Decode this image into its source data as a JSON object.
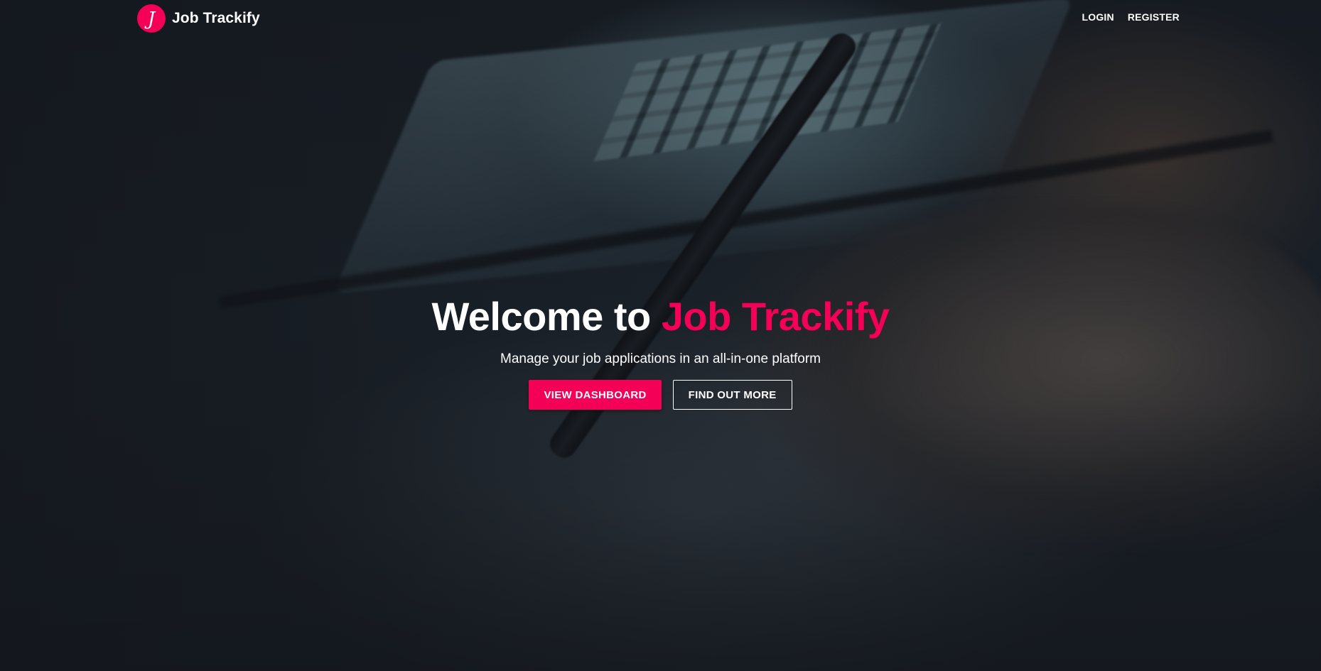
{
  "brand": {
    "logo_letter": "J",
    "name": "Job Trackify",
    "accent_color": "#f50057"
  },
  "nav": {
    "login_label": "LOGIN",
    "register_label": "REGISTER"
  },
  "hero": {
    "title_prefix": "Welcome to",
    "title_highlight": "Job Trackify",
    "subtitle": "Manage your job applications in an all-in-one platform",
    "primary_button_label": "VIEW DASHBOARD",
    "secondary_button_label": "FIND OUT MORE"
  },
  "colors": {
    "accent": "#f50057",
    "text": "#ffffff",
    "background": "#151a21"
  }
}
